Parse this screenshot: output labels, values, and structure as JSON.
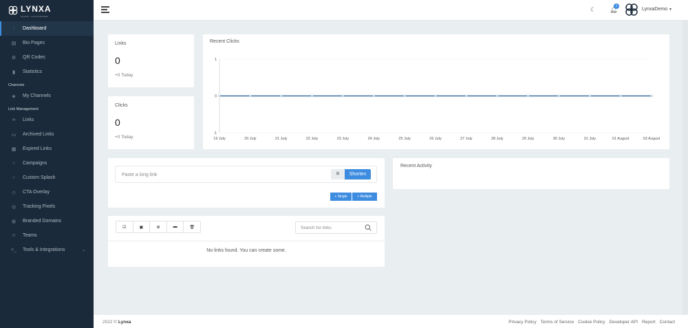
{
  "brand": {
    "name": "LYNXA",
    "tagline": "SHORT. CUSTOMIZED."
  },
  "sidebar": {
    "items_top": [
      {
        "label": "Dashboard",
        "icon": "sliders-icon"
      },
      {
        "label": "Bio Pages",
        "icon": "layout-icon"
      },
      {
        "label": "QR Codes",
        "icon": "qr-icon"
      },
      {
        "label": "Statistics",
        "icon": "bar-chart-icon"
      }
    ],
    "section_channels": "Channels",
    "items_channels": [
      {
        "label": "My Channels",
        "icon": "box-icon"
      }
    ],
    "section_links": "Link Management",
    "items_links": [
      {
        "label": "Links",
        "icon": "link-icon"
      },
      {
        "label": "Archived Links",
        "icon": "archive-icon"
      },
      {
        "label": "Expired Links",
        "icon": "calendar-icon"
      },
      {
        "label": "Campaigns",
        "icon": "circle-icon"
      },
      {
        "label": "Custom Splash",
        "icon": "circle-icon"
      },
      {
        "label": "CTA Overlay",
        "icon": "layers-icon"
      },
      {
        "label": "Tracking Pixels",
        "icon": "target-icon"
      },
      {
        "label": "Branded Domains",
        "icon": "globe-icon"
      },
      {
        "label": "Teams",
        "icon": "users-icon"
      },
      {
        "label": "Tools & Integrations",
        "icon": "terminal-icon"
      }
    ]
  },
  "topbar": {
    "notification_count": "1",
    "username": "LynxaDemo"
  },
  "stats": {
    "links": {
      "title": "Links",
      "value": "0",
      "sub": "+0 Today"
    },
    "clicks": {
      "title": "Clicks",
      "value": "0",
      "sub": "+0 Today"
    }
  },
  "recent_clicks": {
    "title": "Recent Clicks"
  },
  "shortener": {
    "placeholder": "Paste a long link",
    "qr_label": "⊞",
    "shorten_label": "Shorten",
    "single_label": "+ Single",
    "multiple_label": "+ Multiple"
  },
  "recent_activity": {
    "title": "Recent Activity"
  },
  "links_panel": {
    "search_placeholder": "Search for links",
    "empty_message": "No links found. You can create some."
  },
  "footer": {
    "year": "2022 ©",
    "brand": "Lynxa",
    "links": [
      "Privacy Policy",
      "Terms of Service",
      "Cookie Policy",
      "Developer API",
      "Report",
      "Contact"
    ]
  },
  "chart_data": {
    "type": "line",
    "title": "Recent Clicks",
    "categories": [
      "19 July",
      "20 July",
      "21 July",
      "22 July",
      "23 July",
      "24 July",
      "25 July",
      "26 July",
      "27 July",
      "28 July",
      "29 July",
      "30 July",
      "31 July",
      "01 August",
      "02 August"
    ],
    "series": [
      {
        "values": [
          0,
          0,
          0,
          0,
          0,
          0,
          0,
          0,
          0,
          0,
          0,
          0,
          0,
          0,
          0
        ]
      }
    ],
    "y_ticks": [
      "1",
      "0",
      "-1"
    ],
    "ylim": [
      -1,
      1
    ],
    "grid": "horizontal",
    "line_color": "#3b6fa0"
  }
}
